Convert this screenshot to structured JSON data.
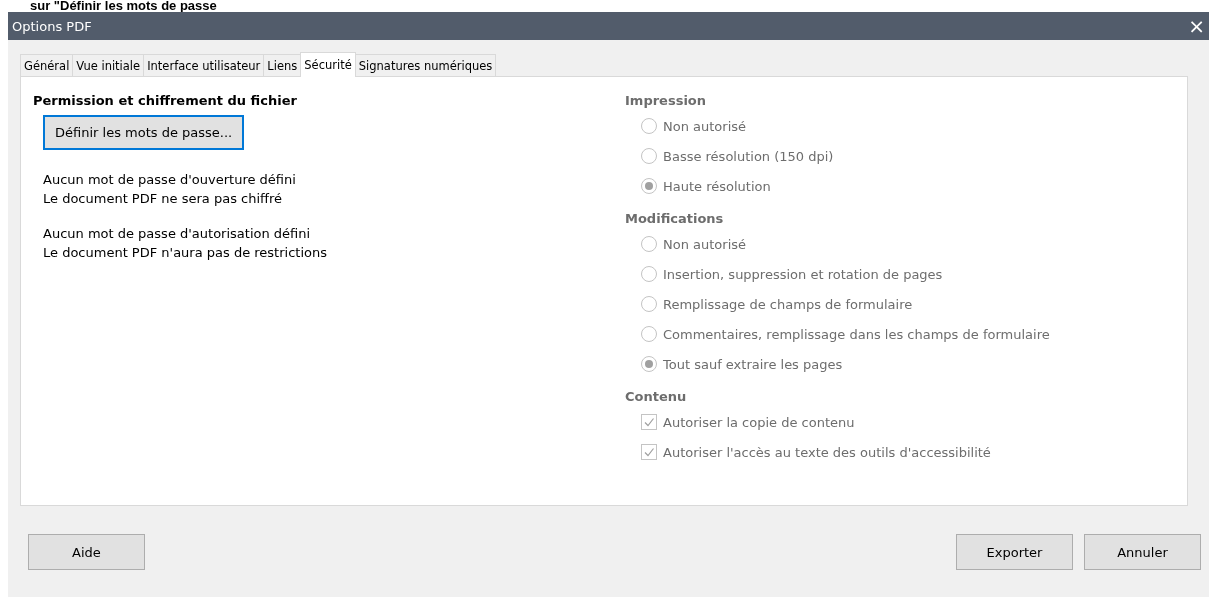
{
  "caption": "sur \"Définir les mots de passe",
  "window": {
    "title": "Options PDF",
    "close": "×"
  },
  "tabs": [
    {
      "label": "Général",
      "selected": false
    },
    {
      "label": "Vue initiale",
      "selected": false
    },
    {
      "label": "Interface utilisateur",
      "selected": false
    },
    {
      "label": "Liens",
      "selected": false
    },
    {
      "label": "Sécurité",
      "selected": true
    },
    {
      "label": "Signatures numériques",
      "selected": false
    }
  ],
  "left": {
    "heading": "Permission et chiffrement du fichier",
    "button": {
      "label": "Définir les mots de passe...",
      "focused": true
    },
    "notes": [
      [
        "Aucun mot de passe d'ouverture défini",
        "Le document PDF ne sera pas chiffré"
      ],
      [
        "Aucun mot de passe d'autorisation défini",
        "Le document PDF n'aura pas de restrictions"
      ]
    ]
  },
  "groups": [
    {
      "title": "Impression",
      "items": [
        {
          "kind": "radio",
          "label": "Non autorisé",
          "selected": false,
          "disabled": true
        },
        {
          "kind": "radio",
          "label": "Basse résolution (150 dpi)",
          "selected": false,
          "disabled": true
        },
        {
          "kind": "radio",
          "label": "Haute résolution",
          "selected": true,
          "disabled": true
        }
      ]
    },
    {
      "title": "Modifications",
      "items": [
        {
          "kind": "radio",
          "label": "Non autorisé",
          "selected": false,
          "disabled": true
        },
        {
          "kind": "radio",
          "label": "Insertion, suppression et rotation de pages",
          "selected": false,
          "disabled": true
        },
        {
          "kind": "radio",
          "label": "Remplissage de champs de formulaire",
          "selected": false,
          "disabled": true
        },
        {
          "kind": "radio",
          "label": "Commentaires, remplissage dans les champs de formulaire",
          "selected": false,
          "disabled": true
        },
        {
          "kind": "radio",
          "label": "Tout sauf extraire les pages",
          "selected": true,
          "disabled": true
        }
      ]
    },
    {
      "title": "Contenu",
      "items": [
        {
          "kind": "checkbox",
          "label": "Autoriser la copie de contenu",
          "checked": true,
          "disabled": true
        },
        {
          "kind": "checkbox",
          "label": "Autoriser l'accès au texte des outils d'accessibilité",
          "checked": true,
          "disabled": true
        }
      ]
    }
  ],
  "buttons": {
    "left": [
      "Aide"
    ],
    "right": [
      "Exporter",
      "Annuler"
    ]
  }
}
